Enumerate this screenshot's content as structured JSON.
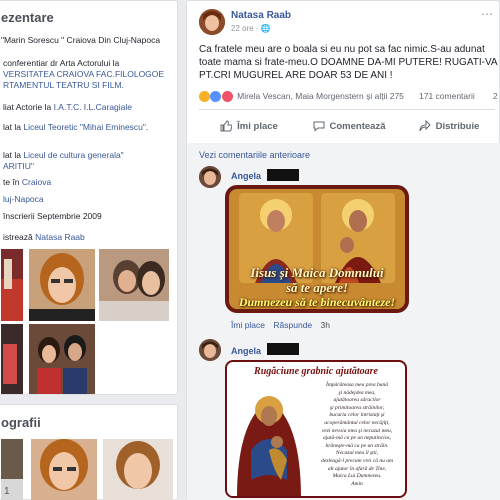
{
  "intro": {
    "title": "ezentare",
    "rows": [
      {
        "text": "\"Marin Sorescu \" Craiova Din Cluj-Napoca"
      },
      {
        "prefix": "conferentiar dr Arta Actorului la",
        "link": "VERSITATEA CRAIOVA FAC.FILOLOGOE",
        "link2": "RTAMENTUL TEATRU SI FILM."
      },
      {
        "prefix": "liat Actorie la",
        "link": "I.A.T.C. I.L.Caragiale"
      },
      {
        "prefix": "lat la",
        "link": "Liceul Teoretic \"Mihai Eminescu\"",
        "suffix": "."
      },
      {
        "prefix": "lat la",
        "link": "Liceul de cultura generala\"",
        "link2": "ARITIU\""
      },
      {
        "prefix": "te în",
        "link": "Craiova"
      },
      {
        "link": "luj-Napoca"
      },
      {
        "prefix": "înscrierii Septembrie 2009"
      },
      {
        "prefix": "istrează",
        "link": "Natasa Raab"
      }
    ]
  },
  "photos_title": "ografii",
  "post": {
    "author": "Natasa Raab",
    "time": "22 ore",
    "time_sep": "·",
    "text": "Ca fratele meu are o boala si eu nu pot sa fac nimic.S-au adunat toate mama si frate-meu.O DOAMNE DA-MI PUTERE! RUGATI-VA PT.CRI MUGUREL ARE DOAR 53 DE ANI !",
    "reactors": "Mirela Vescan, Maia Morgenstern și alții 275",
    "comment_count": "171 comentarii",
    "share_count": "2",
    "actions": {
      "like": "Îmi place",
      "comment": "Comentează",
      "share": "Distribuie"
    },
    "previous_comments": "Vezi comentariile anterioare"
  },
  "comments": [
    {
      "name": "Angela",
      "image_line1": "Iisus și Maica Domnului",
      "image_line2": "să te apere!",
      "image_line3": "Dumnezeu să te binecuvânteze!",
      "like": "Îmi place",
      "reply": "Răspunde",
      "time": "3h",
      "sep": "·"
    },
    {
      "name": "Angela",
      "image_title": "Rugăciune grabnic ajutătoare",
      "prayer": [
        "Împărăteasa mea prea bună",
        "şi nădejdea mea,",
        "ajutătoarea săracilor",
        "şi primitoarea străinilor,",
        "bucuria celor întristaţi şi",
        "acoperământul celor necăjiţi,",
        "vezi nevoia mea şi necazul meu,",
        "ajută-mă ca pe un neputincios,",
        "hrăneşte-mă ca pe un străin.",
        "Necazul meu îl ştii,",
        "dezleagă-l precum vrei că nu am",
        "alt ajutor în afară de Tine,",
        "Maica Lui Dumnezeu.",
        "Amin"
      ]
    }
  ],
  "colors": {
    "link": "#385898",
    "meta": "#90949c",
    "bg": "#e9ebee"
  }
}
